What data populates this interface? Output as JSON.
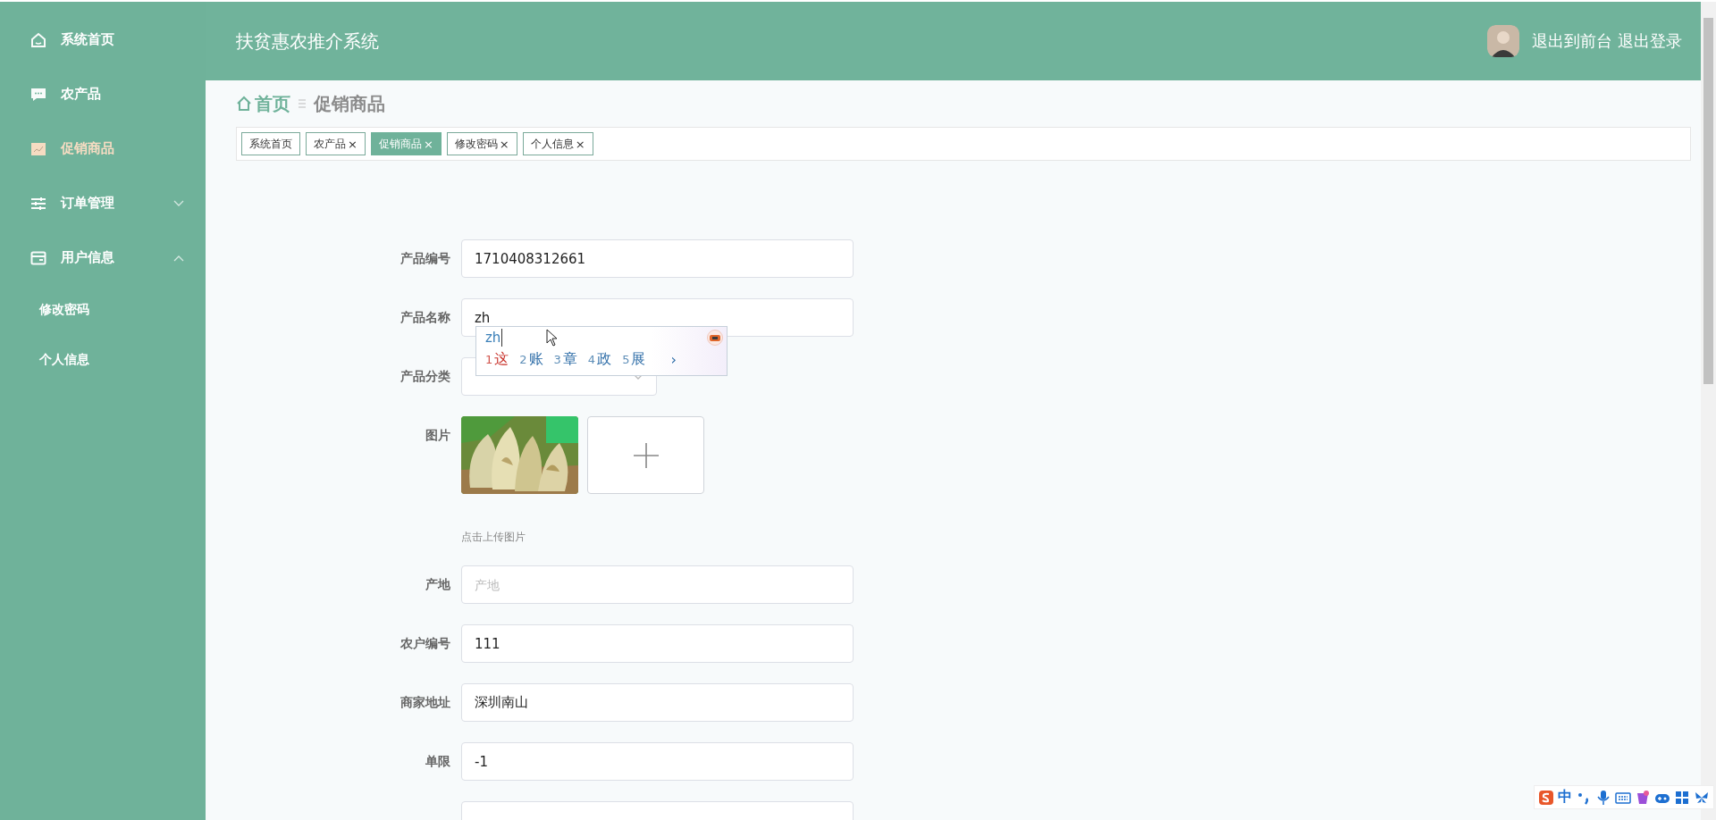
{
  "sidebar": {
    "items": [
      {
        "label": "系统首页",
        "selected": false
      },
      {
        "label": "农产品",
        "selected": false
      },
      {
        "label": "促销商品",
        "selected": true
      },
      {
        "label": "订单管理",
        "selected": false,
        "expanded": false
      },
      {
        "label": "用户信息",
        "selected": false,
        "expanded": true,
        "children": [
          {
            "label": "修改密码",
            "selected": false
          },
          {
            "label": "个人信息",
            "selected": false
          }
        ]
      }
    ]
  },
  "header": {
    "title": "扶贫惠农推介系统",
    "links": [
      "退出到前台",
      "退出登录"
    ]
  },
  "breadcrumb": {
    "home": "首页",
    "current": "促销商品"
  },
  "tabs": [
    {
      "label": "系统首页",
      "selected": false
    },
    {
      "label": "农产品",
      "close": "×",
      "selected": false
    },
    {
      "label": "促销商品",
      "close": "×",
      "selected": true
    },
    {
      "label": "修改密码",
      "close": "×",
      "selected": false
    },
    {
      "label": "个人信息",
      "close": "×",
      "selected": false
    }
  ],
  "form": {
    "fields": [
      {
        "kind": "text",
        "label": "产品编号",
        "value": "1710408312661"
      },
      {
        "kind": "text",
        "label": "产品名称",
        "value": "zh",
        "ime": {
          "composition": "zh",
          "candidates": [
            {
              "index": "1",
              "text": "这",
              "selected": true
            },
            {
              "index": "2",
              "text": "账",
              "selected": false
            },
            {
              "index": "3",
              "text": "章",
              "selected": false
            },
            {
              "index": "4",
              "text": "政",
              "selected": false
            },
            {
              "index": "5",
              "text": "展",
              "selected": false
            }
          ],
          "more": "›"
        }
      },
      {
        "kind": "select",
        "label": "产品分类"
      },
      {
        "label": "图片",
        "hint": "点击上传图片"
      },
      {
        "kind": "text",
        "label": "产地",
        "placeholder": "产地"
      },
      {
        "kind": "text",
        "label": "农户编号",
        "value": "111"
      },
      {
        "kind": "text",
        "label": "商家地址",
        "value": "深圳南山"
      },
      {
        "kind": "text",
        "label": "单限",
        "value": "-1"
      },
      {
        "kind": "text"
      }
    ]
  },
  "ime_toolbar": {
    "mode": "中"
  }
}
